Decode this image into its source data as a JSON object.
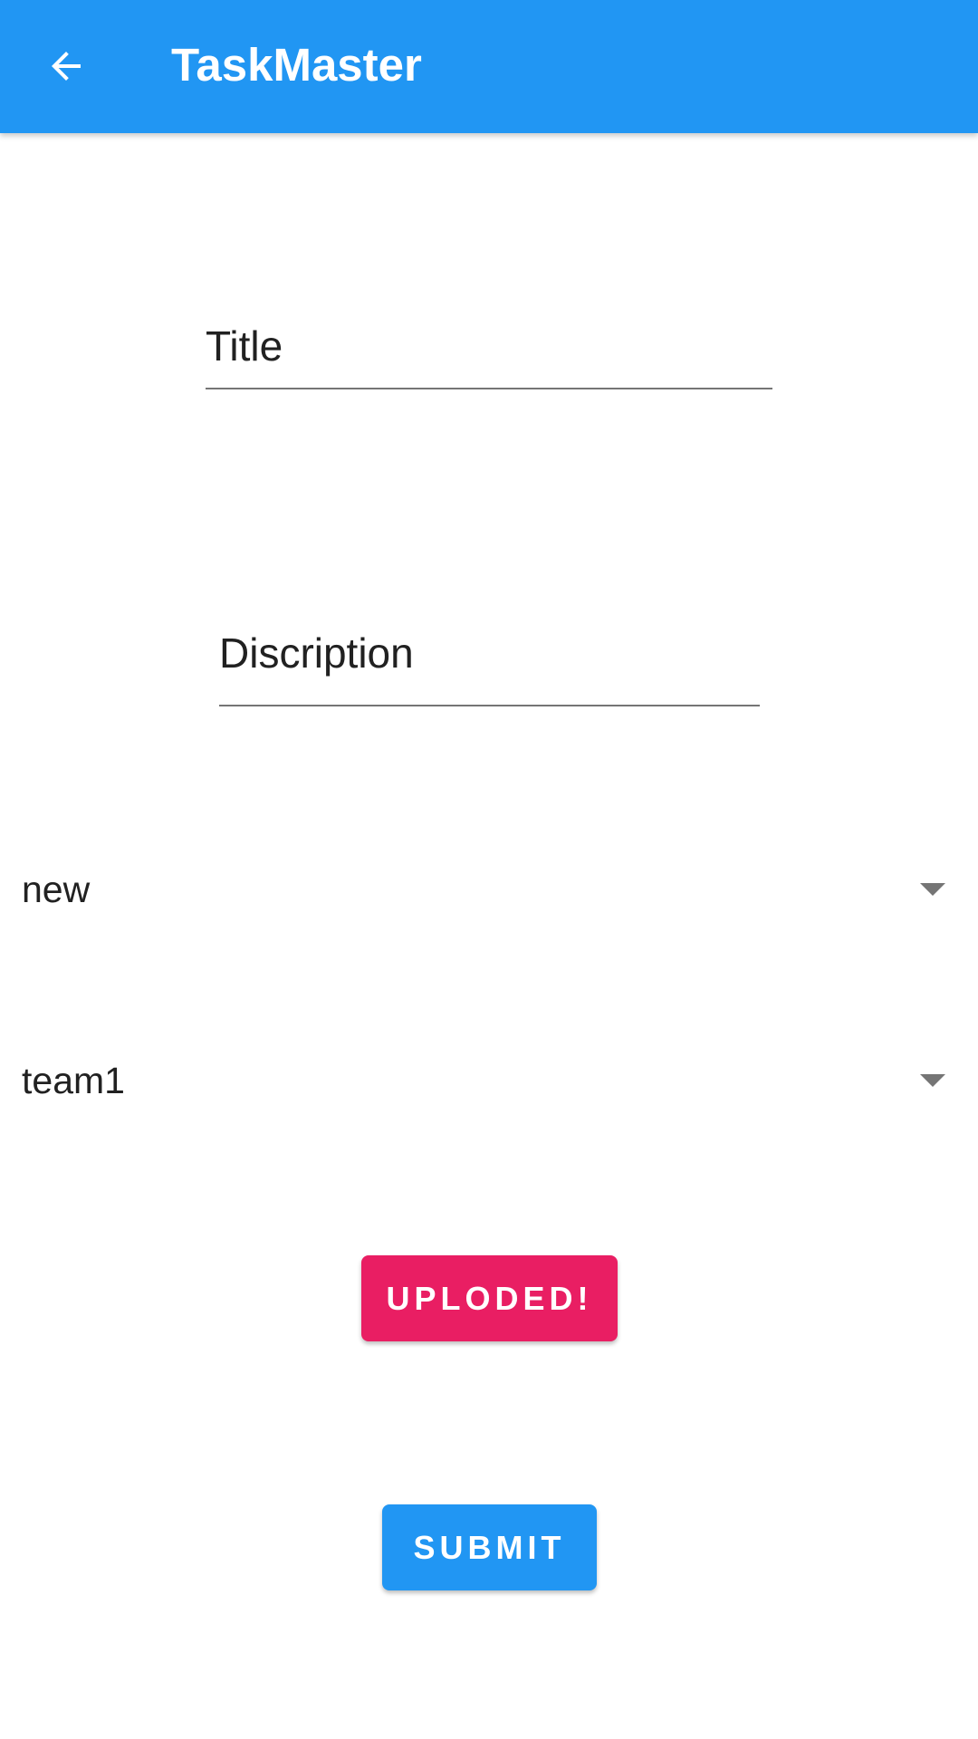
{
  "app_bar": {
    "title": "TaskMaster",
    "back_icon": "arrow-back-icon",
    "background": "#2196f3"
  },
  "form": {
    "title_field": {
      "placeholder": "Title",
      "value": ""
    },
    "description_field": {
      "placeholder": "Discription",
      "value": ""
    },
    "status_spinner": {
      "selected": "new",
      "icon": "dropdown-arrow-icon"
    },
    "team_spinner": {
      "selected": "team1",
      "icon": "dropdown-arrow-icon"
    },
    "upload_button": {
      "label": "UPLODED!",
      "color": "#e91e63"
    },
    "submit_button": {
      "label": "SUBMIT",
      "color": "#2196f3"
    }
  }
}
